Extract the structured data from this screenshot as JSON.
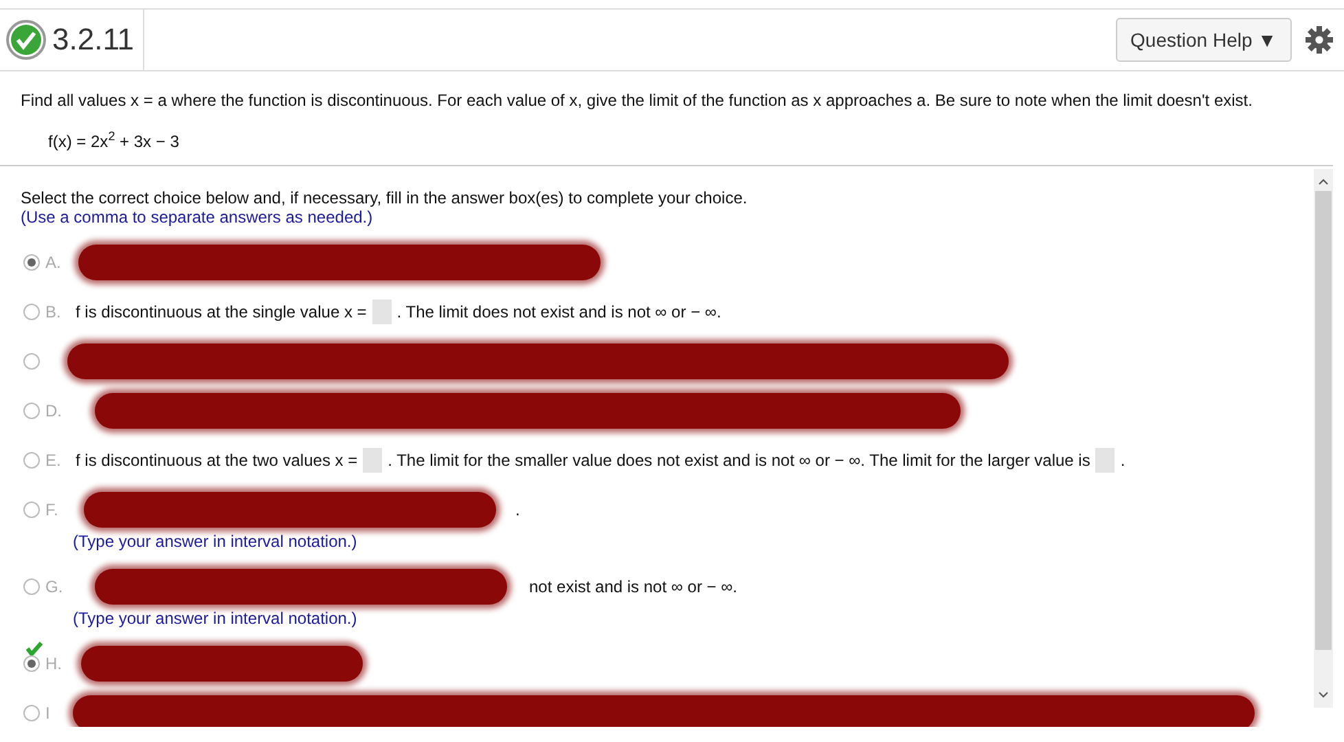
{
  "header": {
    "number": "3.2.11",
    "help_button": "Question Help ▼"
  },
  "question": {
    "text": "Find all values x = a where the function is discontinuous. For each value of x, give the limit of the function as x approaches a. Be sure to note when the limit doesn't exist.",
    "formula": "f(x) = 2x$^{2}$ + 3x − 3"
  },
  "panel": {
    "instruction": "Select the correct choice below and, if necessary, fill in the answer box(es) to complete your choice.",
    "hint": "(Use a comma to separate answers as needed.)",
    "choices": [
      {
        "letter": "A.",
        "selected": true,
        "marked_correct": false,
        "scribbled": true
      },
      {
        "letter": "B.",
        "selected": false,
        "marked_correct": false,
        "scribbled": false,
        "parts": [
          {
            "kind": "text",
            "text": "f is discontinuous at the single value x ="
          },
          {
            "kind": "box"
          },
          {
            "kind": "text",
            "text": ". The limit does not exist and is not ∞ or − ∞."
          }
        ]
      },
      {
        "selected": false,
        "marked_correct": false,
        "scribbled": true
      },
      {
        "letter": "D.",
        "selected": false,
        "marked_correct": false,
        "scribbled": true
      },
      {
        "letter": "E.",
        "selected": false,
        "marked_correct": false,
        "scribbled": false,
        "parts": [
          {
            "kind": "text",
            "text": "f is discontinuous at the two values x ="
          },
          {
            "kind": "box"
          },
          {
            "kind": "text",
            "text": ". The limit for the smaller value does not exist and is not ∞ or − ∞. The limit for the larger value is"
          },
          {
            "kind": "box"
          },
          {
            "kind": "text",
            "text": "."
          }
        ]
      },
      {
        "letter": "F.",
        "selected": false,
        "marked_correct": false,
        "scribbled": true,
        "parts": [
          {
            "kind": "text",
            "text": "."
          }
        ],
        "hint": "(Type your answer in interval notation.)"
      },
      {
        "letter": "G.",
        "selected": false,
        "marked_correct": false,
        "scribbled": true,
        "parts": [
          {
            "kind": "text",
            "text": "not exist and is not ∞ or − ∞."
          }
        ],
        "hint": "(Type your answer in interval notation.)"
      },
      {
        "letter": "H.",
        "selected": true,
        "marked_correct": true,
        "scribbled": true
      },
      {
        "letter": "I",
        "selected": false,
        "marked_correct": false,
        "scribbled": true
      }
    ]
  }
}
